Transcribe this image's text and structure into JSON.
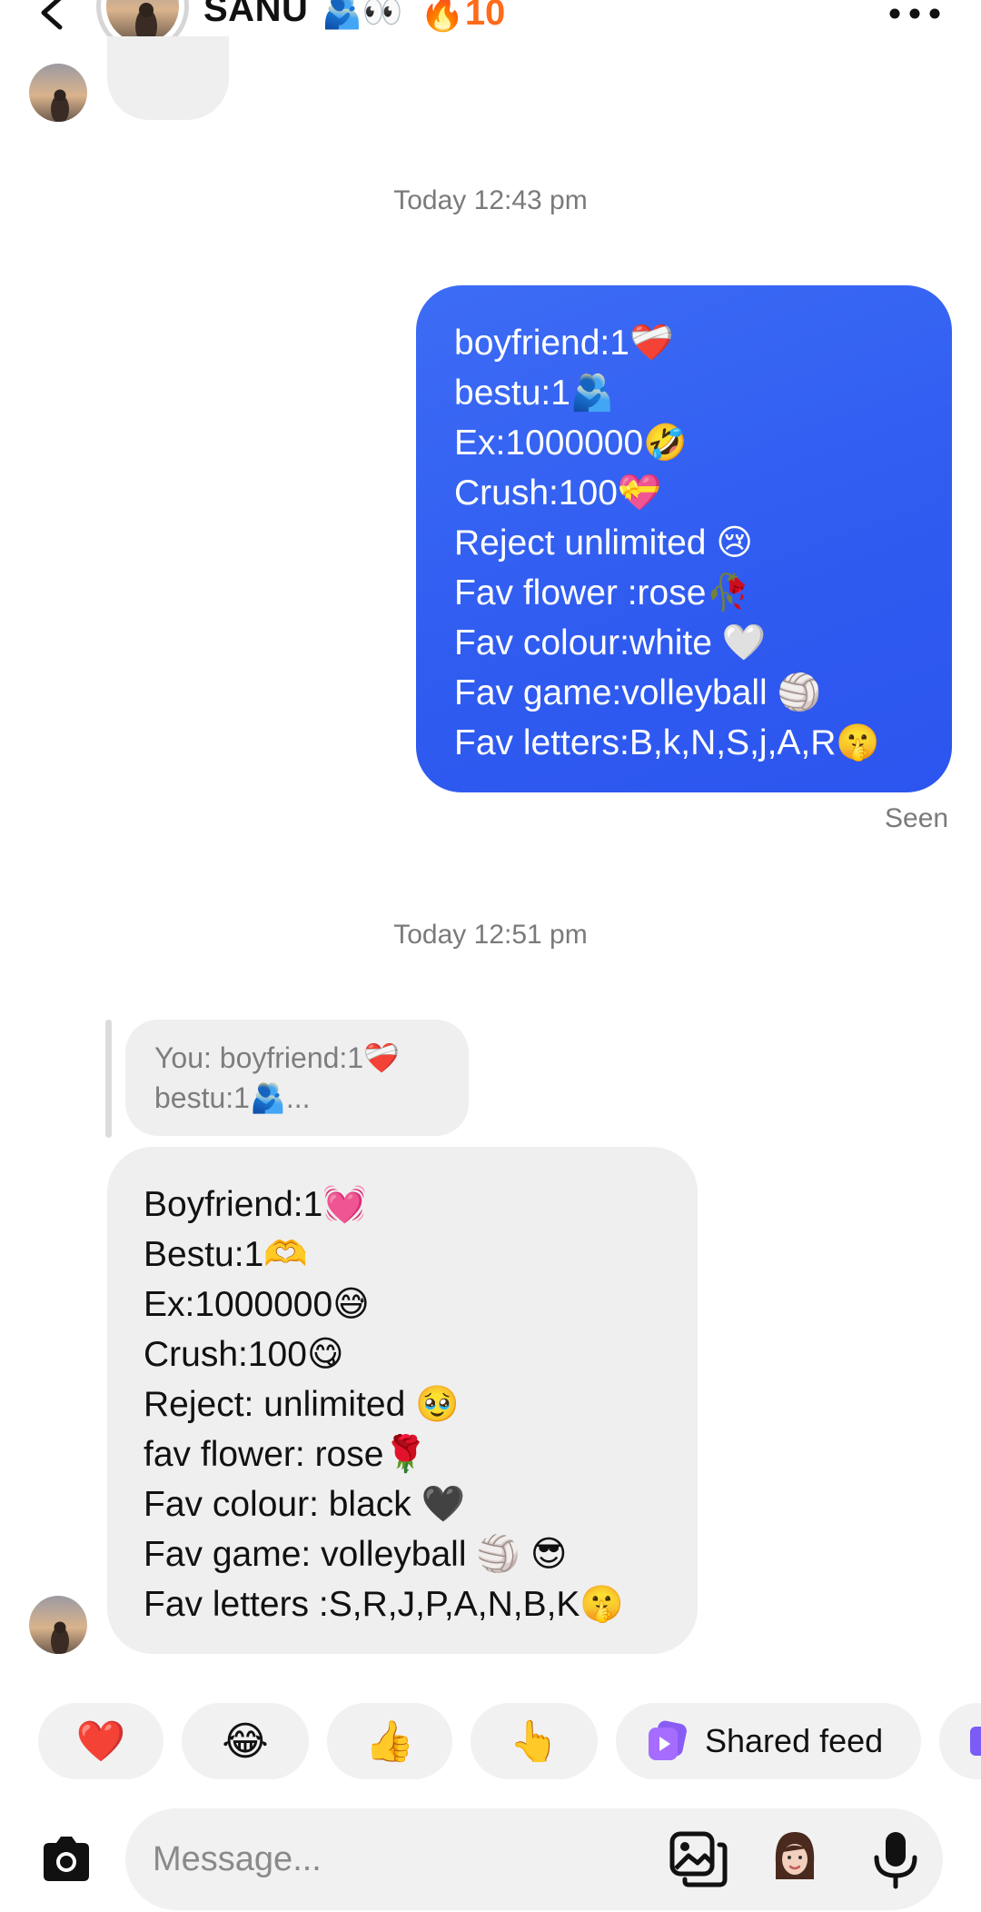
{
  "header": {
    "name": "SANU",
    "name_emojis": "🫂👀",
    "streak_icon": "🔥",
    "streak_count": "10",
    "back_icon": "chevron-left-icon",
    "more_icon": "more-horizontal-icon"
  },
  "conversation": {
    "timestamp_1": "Today 12:43 pm",
    "sent_message": {
      "lines": [
        "boyfriend:1❤️‍🩹",
        "bestu:1🫂",
        "Ex:1000000🤣",
        "Crush:100💝",
        "Reject  unlimited 😢",
        "Fav flower :rose🥀",
        "Fav colour:white 🤍",
        "Fav game:volleyball 🏐",
        "Fav letters:B,k,N,S,j,A,R🤫"
      ]
    },
    "seen_label": "Seen",
    "timestamp_2": "Today 12:51 pm",
    "reply_preview": {
      "line1": "You: boyfriend:1❤️‍🩹",
      "line2": "bestu:1🫂..."
    },
    "received_message": {
      "lines": [
        "Boyfriend:1💓",
        "Bestu:1🫶",
        "Ex:1000000😅",
        "Crush:100😋",
        "Reject: unlimited 🥹",
        "fav flower: rose🌹",
        "Fav colour: black 🖤",
        "Fav game: volleyball 🏐 😎",
        "Fav letters :S,R,J,P,A,N,B,K🤫"
      ]
    }
  },
  "quick_reactions": {
    "items": [
      "❤️",
      "😂",
      "👍",
      "👆"
    ],
    "shared_feed_label": "Shared feed",
    "shared_feed_icon": "shared-feed-icon"
  },
  "composer": {
    "placeholder": "Message...",
    "camera_icon": "camera-icon",
    "gallery_icon": "gallery-icon",
    "sticker_icon": "avatar-sticker-icon",
    "mic_icon": "microphone-icon"
  },
  "colors": {
    "sent_bubble": "#3062F1",
    "received_bubble": "#EFEFEF",
    "streak": "#FF6B1A",
    "meta_text": "#7A7A7A"
  }
}
